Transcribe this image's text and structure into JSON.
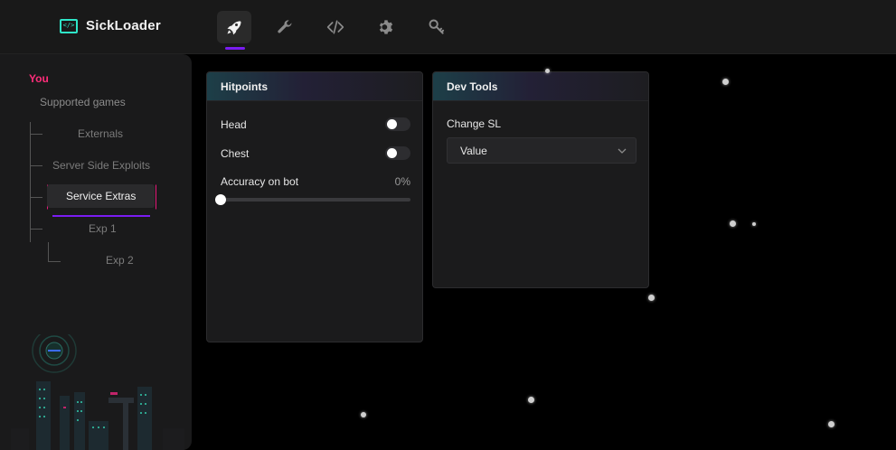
{
  "app": {
    "name": "SickLoader",
    "accent": "#7a1cf2",
    "logo_color": "#2ee6c8",
    "logo_glyph": "</>"
  },
  "nav": [
    {
      "icon": "rocket-icon",
      "active": true
    },
    {
      "icon": "wrench-icon",
      "active": false
    },
    {
      "icon": "code-icon",
      "active": false
    },
    {
      "icon": "gear-icon",
      "active": false
    },
    {
      "icon": "key-icon",
      "active": false
    }
  ],
  "sidebar": {
    "user_label": "You",
    "user_color": "#ff2d7a",
    "root": "Supported games",
    "items": [
      {
        "label": "Externals"
      },
      {
        "label": "Server Side Exploits"
      },
      {
        "label": "Service Extras",
        "selected": true
      },
      {
        "label": "Exp 1"
      },
      {
        "label": "Exp 2"
      }
    ]
  },
  "hitpoints": {
    "title": "Hitpoints",
    "head_label": "Head",
    "head_on": false,
    "chest_label": "Chest",
    "chest_on": false,
    "accuracy_label": "Accuracy on bot",
    "accuracy_value": "0%",
    "accuracy_level": 0
  },
  "devtools": {
    "title": "Dev Tools",
    "change_label": "Change SL",
    "select_value": "Value"
  }
}
